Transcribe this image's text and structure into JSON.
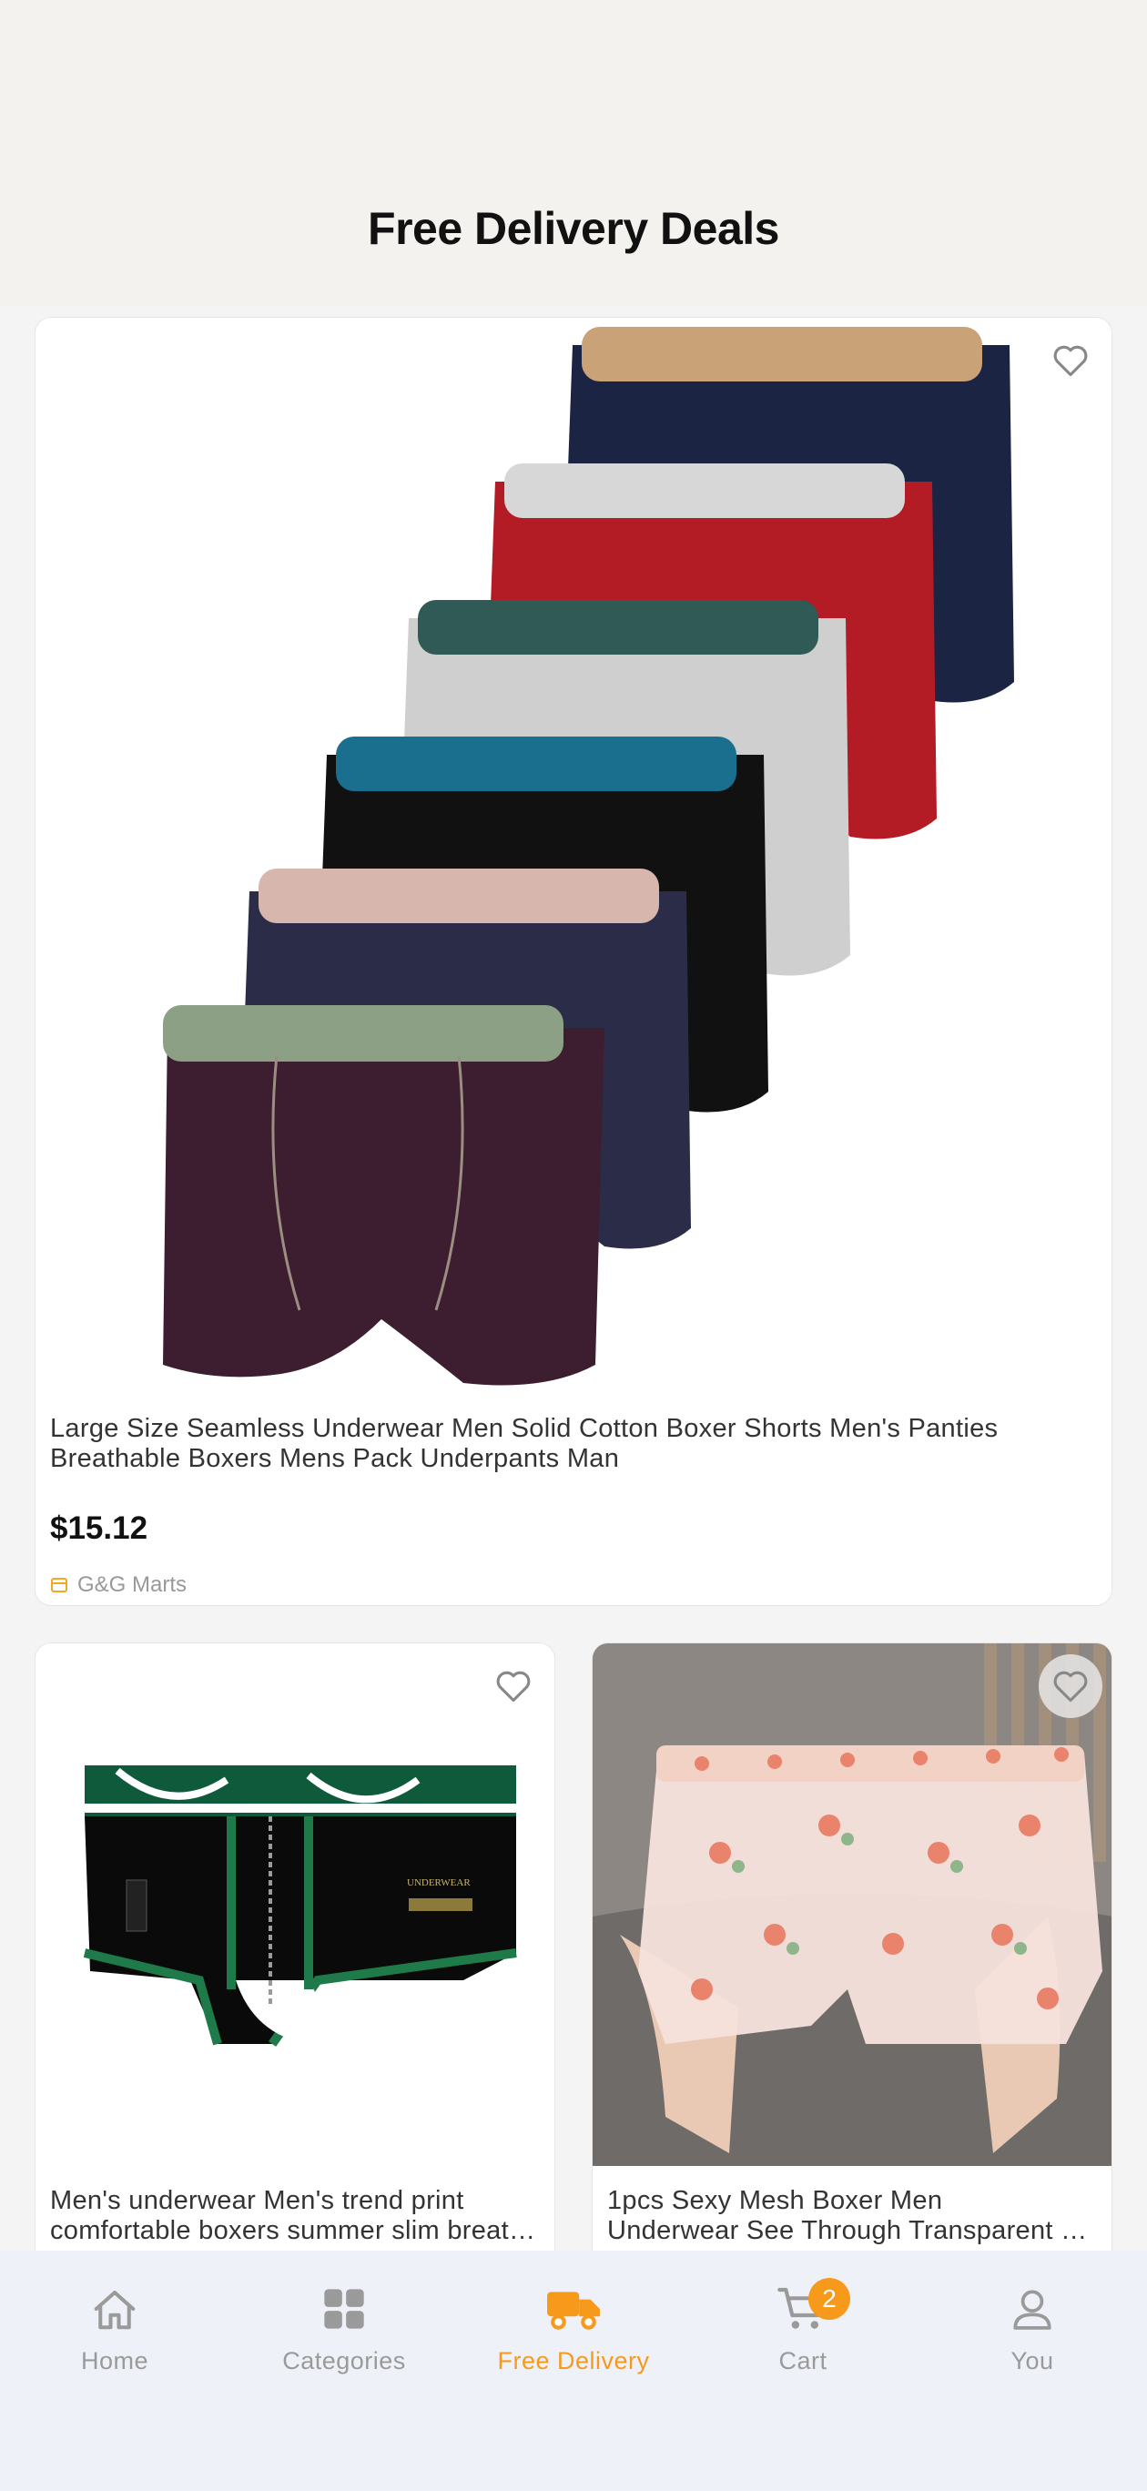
{
  "header": {
    "title": "Free Delivery Deals"
  },
  "products": [
    {
      "title": "Large Size Seamless Underwear Men Solid Cotton Boxer Shorts Men's Panties Breathable Boxers Mens Pack Underpants Man",
      "price": "$15.12",
      "store": "G&G Marts",
      "image": "stack-of-six-boxer-briefs"
    },
    {
      "title_line1": "Men's underwear Men's trend print",
      "title_line2": "comfortable boxers summer slim breathable",
      "image": "black-green-boxer-brief"
    },
    {
      "title_line1": "1pcs Sexy Mesh Boxer Men",
      "title_line2": "Underwear See Through Transparent Floral",
      "image": "floral-mesh-boxer-held-in-hands"
    }
  ],
  "tabbar": {
    "items": [
      {
        "label": "Home",
        "icon": "home-icon"
      },
      {
        "label": "Categories",
        "icon": "grid-icon"
      },
      {
        "label": "Free Delivery",
        "icon": "truck-icon",
        "active": true
      },
      {
        "label": "Cart",
        "icon": "cart-icon",
        "badge": "2"
      },
      {
        "label": "You",
        "icon": "person-icon"
      }
    ]
  },
  "colors": {
    "accent": "#f79a1b",
    "tabbar_bg": "#eff1f8",
    "header_bg": "#f4f2ee"
  }
}
